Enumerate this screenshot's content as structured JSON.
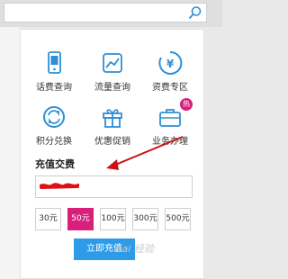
{
  "services": [
    {
      "label": "话费查询",
      "icon": "phone-bill-icon"
    },
    {
      "label": "流量查询",
      "icon": "data-usage-icon"
    },
    {
      "label": "资费专区",
      "icon": "tariff-icon"
    },
    {
      "label": "积分兑换",
      "icon": "points-exchange-icon"
    },
    {
      "label": "优惠促销",
      "icon": "gift-icon"
    },
    {
      "label": "业务办理",
      "icon": "briefcase-icon",
      "badge": "热"
    }
  ],
  "recharge": {
    "title": "充值交费",
    "amounts": [
      "30元",
      "50元",
      "100元",
      "300元",
      "500元"
    ],
    "selected": "50元",
    "submit_label": "立即充值"
  },
  "colors": {
    "accent": "#2e9be8",
    "selected": "#d8207a",
    "annotation": "#cc1111"
  }
}
